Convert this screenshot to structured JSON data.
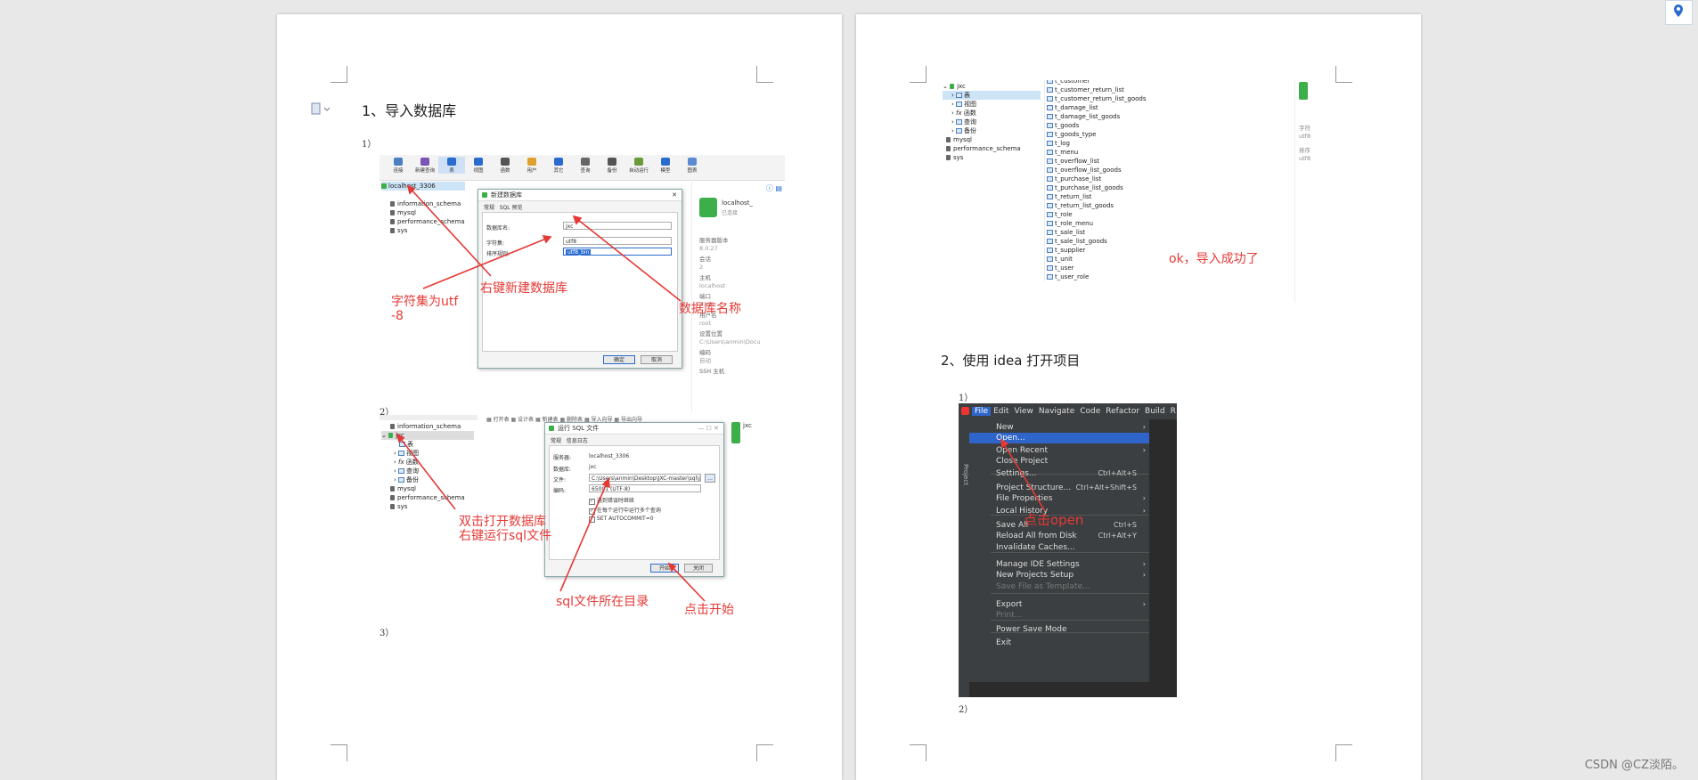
{
  "page1": {
    "heading": "1、导入数据库",
    "step1_label": "1）",
    "step2_label": "2）",
    "step3_label": "3）",
    "shot1": {
      "toolbar": [
        "连接",
        "新建查询",
        "表",
        "视图",
        "函数",
        "用户",
        "其它",
        "查询",
        "备份",
        "自动运行",
        "模型",
        "图表"
      ],
      "tree": [
        "localhost_3306",
        "information_schema",
        "mysql",
        "performance_schema",
        "sys"
      ],
      "dialog_title": "新建数据库",
      "tabs": [
        "常规",
        "SQL 预览"
      ],
      "db_name_label": "数据库名:",
      "db_name_value": "jxc",
      "charset_label": "字符集:",
      "charset_value": "utf8",
      "collation_label": "排序规则:",
      "collation_value": "utf8_bin",
      "ok": "确定",
      "cancel": "取消",
      "conn_name": "localhost_",
      "conn_sub": "已连接",
      "info": [
        "服务器版本",
        "8.0.27",
        "会话",
        "2",
        "主机",
        "localhost",
        "端口",
        "3306",
        "用户名",
        "root",
        "设置位置",
        "C:\\Users\\anmin\\Docu",
        "编码",
        "自动",
        "SSH 主机"
      ]
    },
    "shot2": {
      "toolbar": [
        "打开表",
        "设计表",
        "新建表",
        "删除表",
        "导入向导",
        "导出向导"
      ],
      "tree": [
        "information_schema",
        "jxc",
        "表",
        "视图",
        "函数",
        "查询",
        "备份",
        "mysql",
        "performance_schema",
        "sys"
      ],
      "dialog_title": "运行 SQL 文件",
      "tabs": [
        "常规",
        "信息日志"
      ],
      "server_label": "服务器:",
      "server_value": "localhost_3306",
      "db_label": "数据库:",
      "db_value": "jxc",
      "file_label": "文件:",
      "file_value": "C:\\Users\\anmin\\Desktop\\JXC-master\\sql\\j",
      "encoding_label": "编码:",
      "encoding_value": "65001 (UTF-8)",
      "opt1": "遇到错误时继续",
      "opt2": "在每个运行中运行多个查询",
      "opt3": "SET AUTOCOMMIT=0",
      "start": "开始",
      "close": "关闭",
      "right_name": "jxc"
    },
    "annotations": {
      "charset": "字符集为utf\n-8",
      "new_db": "右键新建数据库",
      "db_name": "数据库名称",
      "open_db": "双击打开数据库\n右键运行sql文件",
      "sql_dir": "sql文件所在目录",
      "click_start": "点击开始"
    }
  },
  "page2": {
    "tree": [
      "jxc",
      "表",
      "视图",
      "函数",
      "查询",
      "备份",
      "mysql",
      "performance_schema",
      "sys"
    ],
    "tables": [
      "t_customer",
      "t_customer_return_list",
      "t_customer_return_list_goods",
      "t_damage_list",
      "t_damage_list_goods",
      "t_goods",
      "t_goods_type",
      "t_log",
      "t_menu",
      "t_overflow_list",
      "t_overflow_list_goods",
      "t_purchase_list",
      "t_purchase_list_goods",
      "t_return_list",
      "t_return_list_goods",
      "t_role",
      "t_role_menu",
      "t_sale_list",
      "t_sale_list_goods",
      "t_supplier",
      "t_unit",
      "t_user",
      "t_user_role"
    ],
    "side_labels": [
      "字符",
      "utf8",
      "排序",
      "utf8"
    ],
    "success": "ok，导入成功了",
    "heading": "2、使用 idea 打开项目",
    "step1_label": "1）",
    "step2_label": "2）",
    "menubar": [
      "File",
      "Edit",
      "View",
      "Navigate",
      "Code",
      "Refactor",
      "Build",
      "R"
    ],
    "menu": [
      {
        "label": "New",
        "shortcut": "",
        "arrow": true
      },
      {
        "label": "Open...",
        "shortcut": "",
        "arrow": false
      },
      {
        "label": "Open Recent",
        "shortcut": "",
        "arrow": true
      },
      {
        "label": "Close Project",
        "shortcut": "",
        "arrow": false
      },
      {
        "label": "Settings...",
        "shortcut": "Ctrl+Alt+S",
        "arrow": false
      },
      {
        "label": "Project Structure...",
        "shortcut": "Ctrl+Alt+Shift+S",
        "arrow": false
      },
      {
        "label": "File Properties",
        "shortcut": "",
        "arrow": true
      },
      {
        "label": "Local History",
        "shortcut": "",
        "arrow": true
      },
      {
        "label": "Save All",
        "shortcut": "Ctrl+S",
        "arrow": false
      },
      {
        "label": "Reload All from Disk",
        "shortcut": "Ctrl+Alt+Y",
        "arrow": false
      },
      {
        "label": "Invalidate Caches...",
        "shortcut": "",
        "arrow": false
      },
      {
        "label": "Manage IDE Settings",
        "shortcut": "",
        "arrow": true
      },
      {
        "label": "New Projects Setup",
        "shortcut": "",
        "arrow": true
      },
      {
        "label": "Save File as Template...",
        "shortcut": "",
        "arrow": false
      },
      {
        "label": "Export",
        "shortcut": "",
        "arrow": true
      },
      {
        "label": "Print...",
        "shortcut": "",
        "arrow": false
      },
      {
        "label": "Power Save Mode",
        "shortcut": "",
        "arrow": false
      },
      {
        "label": "Exit",
        "shortcut": "",
        "arrow": false
      }
    ],
    "sidebar_label": "Project",
    "click_open": "点击open"
  },
  "watermark": "CSDN @CZ淡陌。",
  "colors": {
    "annotation": "#e53935",
    "menu_bg": "#3c3f41",
    "menu_highlight": "#2f65ca"
  }
}
